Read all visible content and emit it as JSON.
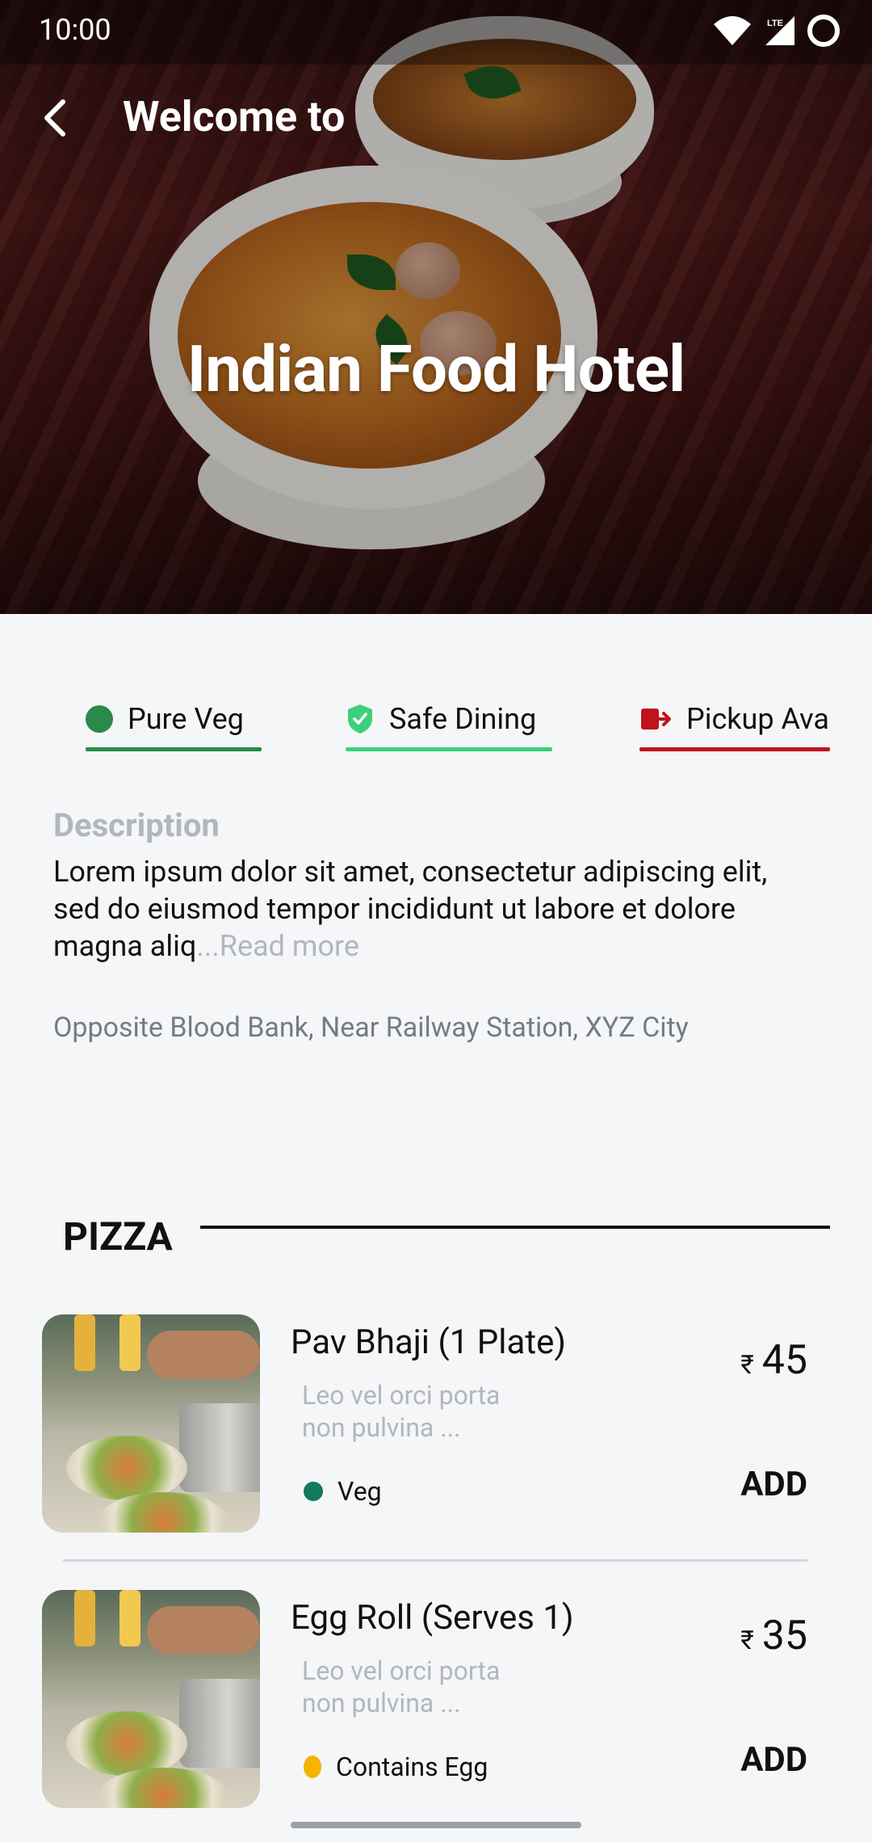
{
  "status_bar": {
    "time": "10:00",
    "network": "LTE"
  },
  "header": {
    "back_icon": "chevron-left-icon",
    "welcome": "Welcome to",
    "hotel_name": "Indian Food Hotel"
  },
  "tags": [
    {
      "label": "Pure Veg",
      "icon": "green-dot-icon",
      "color": "#2a8a4a"
    },
    {
      "label": "Safe Dining",
      "icon": "shield-check-icon",
      "color": "#3ecf7b"
    },
    {
      "label": "Pickup Ava",
      "icon": "pickup-exit-icon",
      "color": "#c0141c"
    }
  ],
  "description": {
    "title": "Description",
    "text": "Lorem ipsum dolor sit amet, consectetur adipiscing elit, sed do eiusmod tempor incididunt ut labore et dolore magna aliq",
    "read_more": "...Read more"
  },
  "address": "Opposite Blood Bank, Near Railway Station, XYZ City",
  "section": {
    "title": "PIZZA"
  },
  "menu_items": [
    {
      "name": "Pav Bhaji (1 Plate)",
      "description_line1": "Leo vel orci porta",
      "description_line2": "non pulvina ...",
      "tag": "Veg",
      "currency": "₹",
      "price": "45",
      "add_label": "ADD"
    },
    {
      "name": "Egg Roll (Serves 1)",
      "description_line1": "Leo vel orci porta",
      "description_line2": "non pulvina ...",
      "tag": "Contains Egg",
      "currency": "₹",
      "price": "35",
      "add_label": "ADD"
    }
  ],
  "colors": {
    "veg": "#13795b",
    "egg": "#f4b400",
    "muted": "#b2b6bd",
    "background": "#f5f6f8"
  }
}
